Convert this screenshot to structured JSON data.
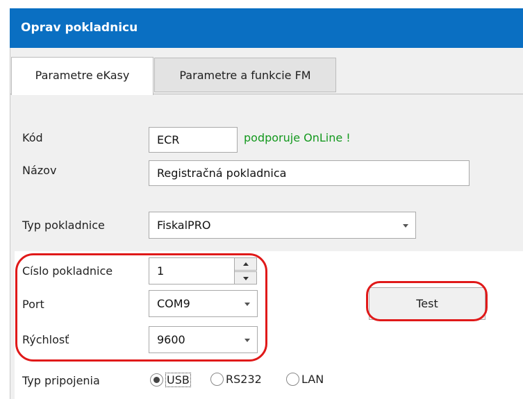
{
  "window": {
    "title": "Oprav pokladnicu"
  },
  "tabs": [
    {
      "label": "Parametre eKasy",
      "active": true
    },
    {
      "label": "Parametre a funkcie FM",
      "active": false
    }
  ],
  "form": {
    "kod": {
      "label": "Kód",
      "value": "ECR",
      "note": "podporuje OnLine !"
    },
    "nazov": {
      "label": "Názov",
      "value": "Registračná pokladnica"
    },
    "typ_pokladnice": {
      "label": "Typ pokladnice",
      "value": "FiskalPRO"
    },
    "cislo_pokladnice": {
      "label": "Císlo pokladnice",
      "value": "1"
    },
    "port": {
      "label": "Port",
      "value": "COM9"
    },
    "rychlost": {
      "label": "Rýchlosť",
      "value": "9600"
    },
    "test_button": {
      "label": "Test"
    },
    "typ_pripojenia": {
      "label": "Typ pripojenia",
      "options": [
        "USB",
        "RS232",
        "LAN"
      ],
      "selected": "USB"
    }
  },
  "colors": {
    "titlebar": "#0a6fc2",
    "online_note": "#14991e",
    "highlight": "#e01919"
  }
}
